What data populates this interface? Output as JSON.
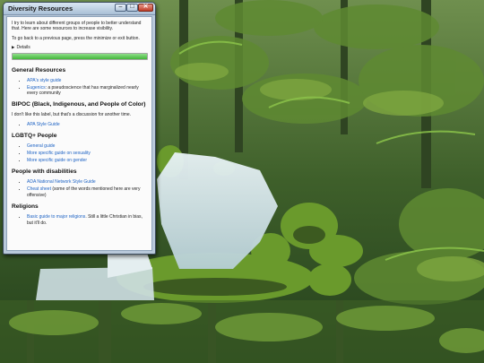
{
  "window": {
    "title": "Diversity Resources",
    "buttons": {
      "minimize": "–",
      "maximize": "□",
      "close": "✕"
    }
  },
  "content": {
    "intro": "I try to learn about different groups of people to better understand that. Here are some resources to increase visibility.",
    "nav_note": "To go back to a previous page, press the minimize or exit button.",
    "details_label": "Details",
    "progress_percent": 100,
    "sections": {
      "general": {
        "heading": "General Resources",
        "items": [
          {
            "link": "APA's style guide",
            "suffix": ""
          },
          {
            "link": "Eugenics",
            "suffix": ": a pseudoscience that has marginalized nearly every community"
          }
        ]
      },
      "bipoc": {
        "heading": "BIPOC (Black, Indigenous, and People of Color)",
        "note": "I don't like this label, but that's a discussion for another time.",
        "items": [
          {
            "link": "APA Style Guide",
            "suffix": ""
          }
        ]
      },
      "lgbtq": {
        "heading": "LGBTQ+ People",
        "items": [
          {
            "link": "General guide",
            "suffix": ""
          },
          {
            "link": "More specific guide on sexuality",
            "suffix": ""
          },
          {
            "link": "More specific guide on gender",
            "suffix": ""
          }
        ]
      },
      "disabilities": {
        "heading": "People with disabilities",
        "items": [
          {
            "link": "ADA National Network Style Guide",
            "suffix": ""
          },
          {
            "link": "Cheat sheet",
            "suffix": " (some of the words mentioned here are very offensive)"
          }
        ]
      },
      "religions": {
        "heading": "Religions",
        "items": [
          {
            "link": "Basic guide to major religions",
            "suffix": ". Still a little Christian in bias, but it'll do."
          }
        ]
      }
    }
  },
  "colors": {
    "link": "#1e63c4",
    "progress_fill": "#43b53a",
    "titlebar": "#a9bfd6"
  },
  "icons": {
    "details_toggle": "triangle-right-icon"
  }
}
